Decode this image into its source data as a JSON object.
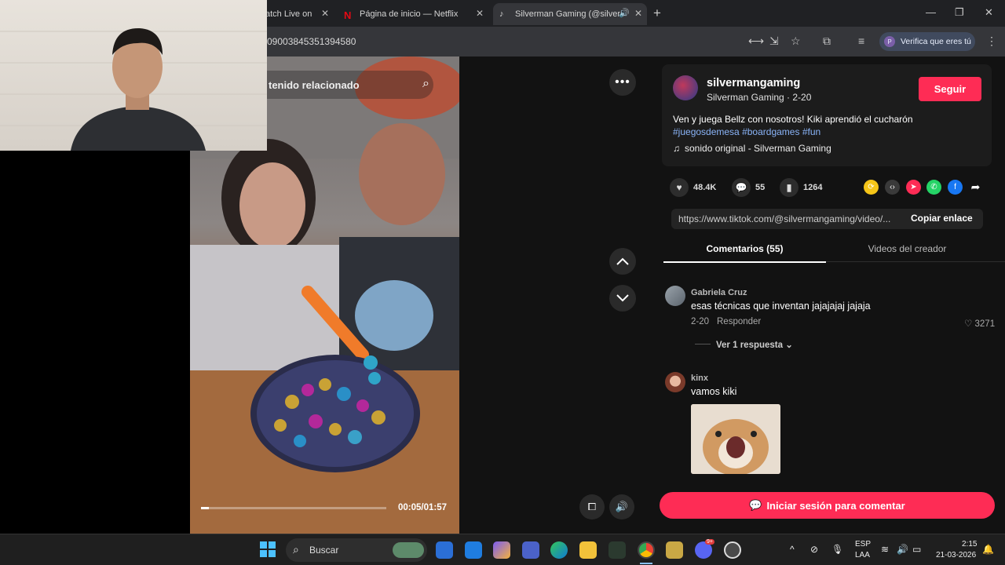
{
  "browser": {
    "tabs": [
      {
        "label": "atch Live on",
        "active": false
      },
      {
        "label": "Página de inicio — Netflix",
        "active": false
      },
      {
        "label": "Silverman Gaming (@silver",
        "active": true
      }
    ],
    "url_partial": "09003845351394580",
    "verify_label": "Verifica que eres tú",
    "verify_avatar": "P"
  },
  "video": {
    "search_placeholder": "tenido relacionado",
    "time": "00:05/01:57",
    "progress_fraction": 0.042
  },
  "creator": {
    "username": "silvermangaming",
    "subtitle": "Silverman Gaming · 2-20",
    "follow_label": "Seguir",
    "description": "Ven y juega Bellz con nosotros! Kiki aprendió el cucharón",
    "hashtags": [
      "#juegosdemesa",
      "#boardgames",
      "#fun"
    ],
    "sound": "sonido original - Silverman Gaming"
  },
  "stats": {
    "likes": "48.4K",
    "comments": "55",
    "saves": "1264"
  },
  "link": {
    "url": "https://www.tiktok.com/@silvermangaming/video/...",
    "copy_label": "Copiar enlace"
  },
  "panel_tabs": {
    "comments": "Comentarios (55)",
    "videos": "Videos del creador"
  },
  "comments": [
    {
      "author": "Gabriela Cruz",
      "text": "esas técnicas que inventan jajajajaj jajaja",
      "date": "2-20",
      "reply_label": "Responder",
      "likes": "3271",
      "view_replies": "Ver 1 respuesta"
    },
    {
      "author": "kinx",
      "text": "vamos kiki"
    }
  ],
  "login_label": "Iniciar sesión para comentar",
  "taskbar": {
    "search_label": "Buscar",
    "lang_top": "ESP",
    "lang_bottom": "LAA",
    "time": "2:15",
    "date": "21-03-2026",
    "discord_badge": "9+"
  },
  "colors": {
    "accent": "#fe2c55",
    "hashtag": "#8ab4f8"
  }
}
